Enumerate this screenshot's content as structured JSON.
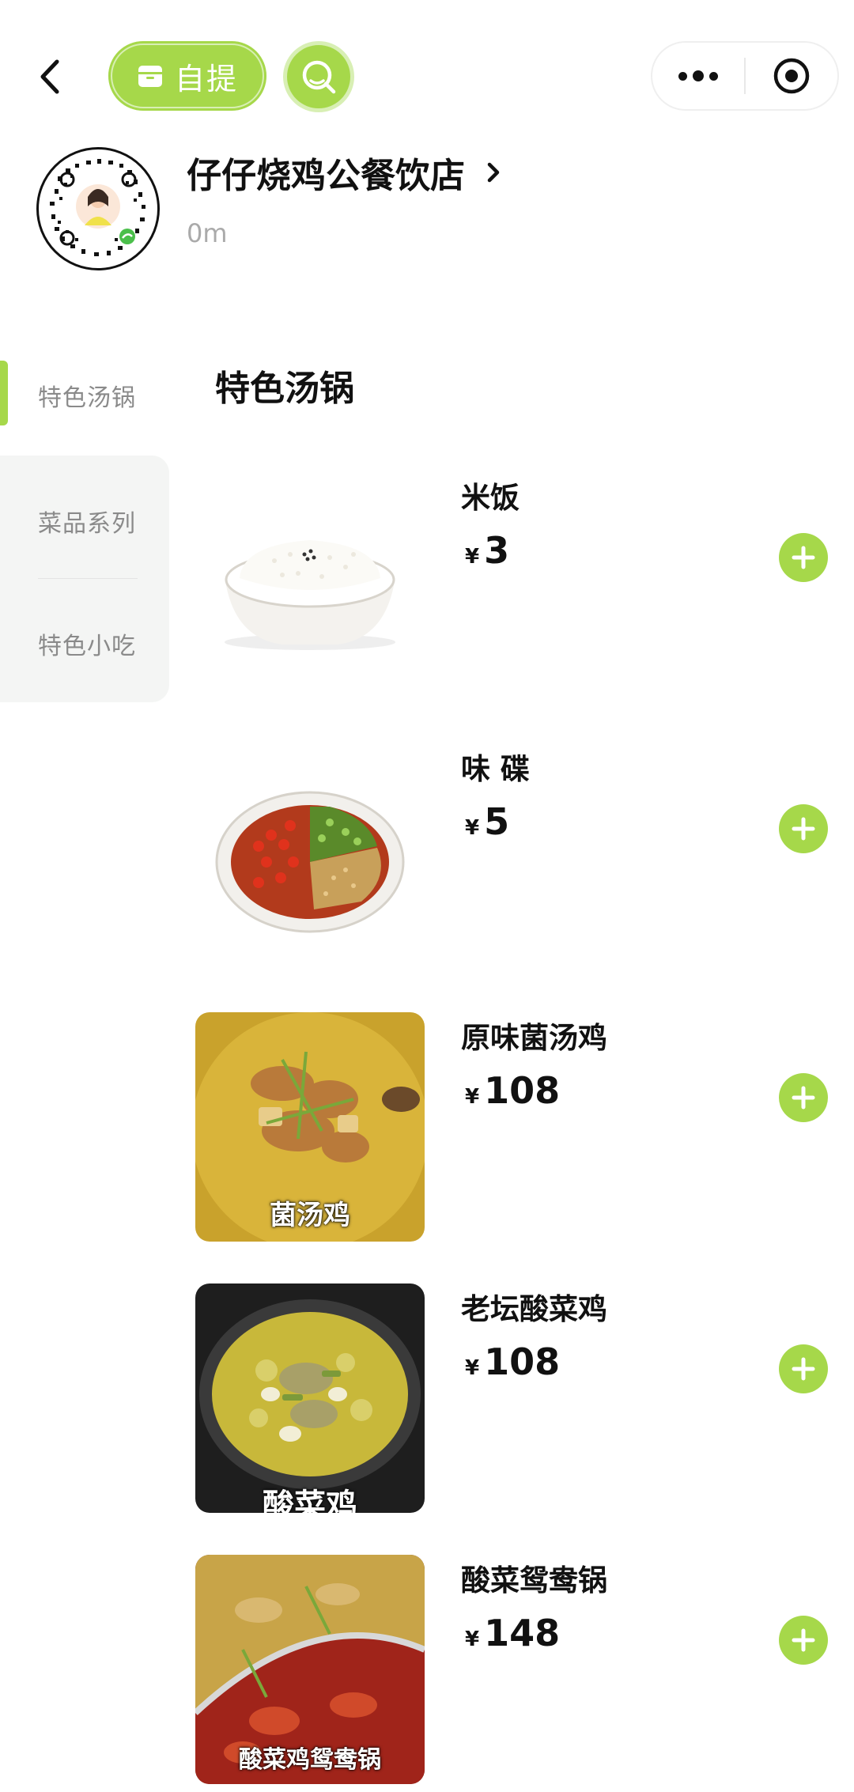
{
  "toolbar": {
    "pickup_label": "自提"
  },
  "store": {
    "name": "仔仔烧鸡公餐饮店",
    "distance": "0m"
  },
  "sidebar": {
    "items": [
      {
        "label": "特色汤锅",
        "active": true
      },
      {
        "label": "菜品系列",
        "active": false
      },
      {
        "label": "特色小吃",
        "active": false
      }
    ]
  },
  "section": {
    "title": "特色汤锅"
  },
  "currency": "¥",
  "dishes": [
    {
      "name": "米饭",
      "price": "3"
    },
    {
      "name": "味 碟",
      "price": "5"
    },
    {
      "name": "原味菌汤鸡",
      "price": "108",
      "image_caption": "菌汤鸡"
    },
    {
      "name": "老坛酸菜鸡",
      "price": "108",
      "image_caption": "酸菜鸡"
    },
    {
      "name": "酸菜鸳鸯锅",
      "price": "148",
      "image_caption": "酸菜鸡鸳鸯锅"
    }
  ],
  "colors": {
    "accent": "#a6d84a",
    "accent_light": "#d8efb4",
    "muted_text": "#8a8a8a"
  },
  "icons": [
    "chevron-left-icon",
    "package-icon",
    "search-icon",
    "more-icon",
    "target-icon",
    "plus-icon",
    "chevron-right-icon"
  ]
}
